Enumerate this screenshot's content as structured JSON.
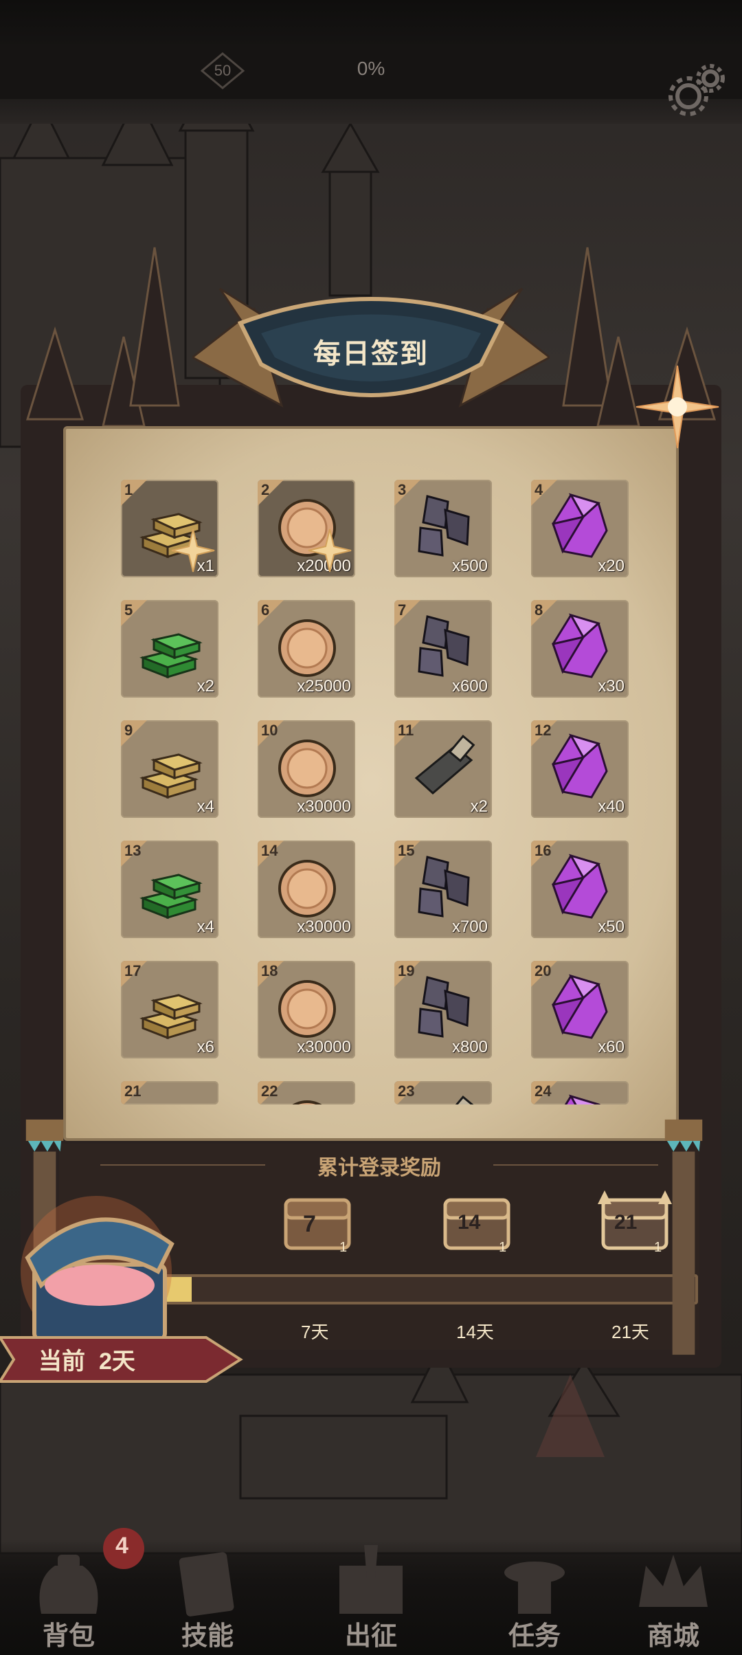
{
  "hud": {
    "level": "50",
    "progress": "0%"
  },
  "title": "每日签到",
  "days": [
    {
      "day": "1",
      "item": "gold-bar",
      "qty": "x1",
      "claimed": true
    },
    {
      "day": "2",
      "item": "copper-coin",
      "qty": "x20000",
      "claimed": true
    },
    {
      "day": "3",
      "item": "dark-ore",
      "qty": "x500",
      "claimed": false
    },
    {
      "day": "4",
      "item": "purple-crystal",
      "qty": "x20",
      "claimed": false
    },
    {
      "day": "5",
      "item": "green-bar",
      "qty": "x2",
      "claimed": false
    },
    {
      "day": "6",
      "item": "copper-coin",
      "qty": "x25000",
      "claimed": false
    },
    {
      "day": "7",
      "item": "dark-ore",
      "qty": "x600",
      "claimed": false
    },
    {
      "day": "8",
      "item": "purple-crystal",
      "qty": "x30",
      "claimed": false
    },
    {
      "day": "9",
      "item": "gold-bar",
      "qty": "x4",
      "claimed": false
    },
    {
      "day": "10",
      "item": "copper-coin",
      "qty": "x30000",
      "claimed": false
    },
    {
      "day": "11",
      "item": "scroll",
      "qty": "x2",
      "claimed": false
    },
    {
      "day": "12",
      "item": "purple-crystal",
      "qty": "x40",
      "claimed": false
    },
    {
      "day": "13",
      "item": "green-bar",
      "qty": "x4",
      "claimed": false
    },
    {
      "day": "14",
      "item": "copper-coin",
      "qty": "x30000",
      "claimed": false
    },
    {
      "day": "15",
      "item": "dark-ore",
      "qty": "x700",
      "claimed": false
    },
    {
      "day": "16",
      "item": "purple-crystal",
      "qty": "x50",
      "claimed": false
    },
    {
      "day": "17",
      "item": "gold-bar",
      "qty": "x6",
      "claimed": false
    },
    {
      "day": "18",
      "item": "copper-coin",
      "qty": "x30000",
      "claimed": false
    },
    {
      "day": "19",
      "item": "dark-ore",
      "qty": "x800",
      "claimed": false
    },
    {
      "day": "20",
      "item": "purple-crystal",
      "qty": "x60",
      "claimed": false
    },
    {
      "day": "21",
      "item": "green-bar",
      "qty": "",
      "claimed": false
    },
    {
      "day": "22",
      "item": "copper-coin",
      "qty": "",
      "claimed": false
    },
    {
      "day": "23",
      "item": "scroll",
      "qty": "",
      "claimed": false
    },
    {
      "day": "24",
      "item": "purple-crystal",
      "qty": "",
      "claimed": false
    }
  ],
  "cumulative": {
    "title": "累计登录奖励",
    "progress_fraction": 0.05,
    "milestones": [
      {
        "badge": "7",
        "count": "1",
        "label": "7天"
      },
      {
        "badge": "14",
        "count": "1",
        "label": "14天"
      },
      {
        "badge": "21",
        "count": "1",
        "label": "21天"
      }
    ],
    "current_label": "当前",
    "current_value": "2天"
  },
  "nav": {
    "items": [
      {
        "label": "背包",
        "icon": "bag-icon"
      },
      {
        "label": "技能",
        "icon": "skill-card-icon"
      },
      {
        "label": "出征",
        "icon": "expedition-map-icon"
      },
      {
        "label": "任务",
        "icon": "quest-scroll-icon"
      },
      {
        "label": "商城",
        "icon": "shop-crown-icon"
      }
    ],
    "badge": "4"
  },
  "colors": {
    "paper": "#d9c7a6",
    "frame": "#2b2220",
    "gold": "#e7c96e",
    "purple": "#b44bd8",
    "green": "#3f9d3a"
  }
}
